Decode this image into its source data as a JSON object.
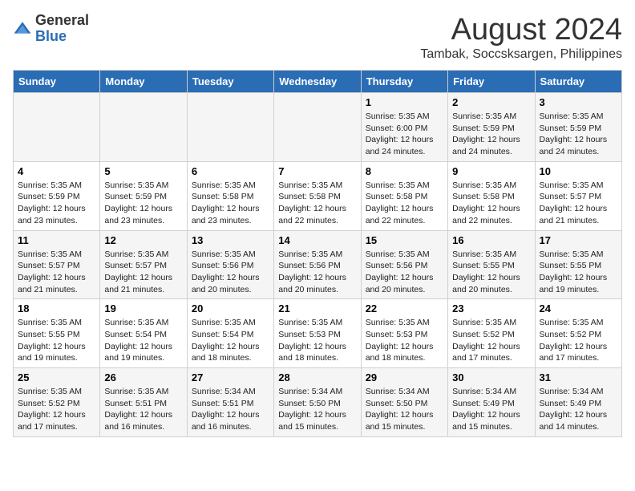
{
  "header": {
    "logo_general": "General",
    "logo_blue": "Blue",
    "month_year": "August 2024",
    "location": "Tambak, Soccsksargen, Philippines"
  },
  "days_of_week": [
    "Sunday",
    "Monday",
    "Tuesday",
    "Wednesday",
    "Thursday",
    "Friday",
    "Saturday"
  ],
  "weeks": [
    [
      {
        "day": "",
        "info": ""
      },
      {
        "day": "",
        "info": ""
      },
      {
        "day": "",
        "info": ""
      },
      {
        "day": "",
        "info": ""
      },
      {
        "day": "1",
        "info": "Sunrise: 5:35 AM\nSunset: 6:00 PM\nDaylight: 12 hours\nand 24 minutes."
      },
      {
        "day": "2",
        "info": "Sunrise: 5:35 AM\nSunset: 5:59 PM\nDaylight: 12 hours\nand 24 minutes."
      },
      {
        "day": "3",
        "info": "Sunrise: 5:35 AM\nSunset: 5:59 PM\nDaylight: 12 hours\nand 24 minutes."
      }
    ],
    [
      {
        "day": "4",
        "info": "Sunrise: 5:35 AM\nSunset: 5:59 PM\nDaylight: 12 hours\nand 23 minutes."
      },
      {
        "day": "5",
        "info": "Sunrise: 5:35 AM\nSunset: 5:59 PM\nDaylight: 12 hours\nand 23 minutes."
      },
      {
        "day": "6",
        "info": "Sunrise: 5:35 AM\nSunset: 5:58 PM\nDaylight: 12 hours\nand 23 minutes."
      },
      {
        "day": "7",
        "info": "Sunrise: 5:35 AM\nSunset: 5:58 PM\nDaylight: 12 hours\nand 22 minutes."
      },
      {
        "day": "8",
        "info": "Sunrise: 5:35 AM\nSunset: 5:58 PM\nDaylight: 12 hours\nand 22 minutes."
      },
      {
        "day": "9",
        "info": "Sunrise: 5:35 AM\nSunset: 5:58 PM\nDaylight: 12 hours\nand 22 minutes."
      },
      {
        "day": "10",
        "info": "Sunrise: 5:35 AM\nSunset: 5:57 PM\nDaylight: 12 hours\nand 21 minutes."
      }
    ],
    [
      {
        "day": "11",
        "info": "Sunrise: 5:35 AM\nSunset: 5:57 PM\nDaylight: 12 hours\nand 21 minutes."
      },
      {
        "day": "12",
        "info": "Sunrise: 5:35 AM\nSunset: 5:57 PM\nDaylight: 12 hours\nand 21 minutes."
      },
      {
        "day": "13",
        "info": "Sunrise: 5:35 AM\nSunset: 5:56 PM\nDaylight: 12 hours\nand 20 minutes."
      },
      {
        "day": "14",
        "info": "Sunrise: 5:35 AM\nSunset: 5:56 PM\nDaylight: 12 hours\nand 20 minutes."
      },
      {
        "day": "15",
        "info": "Sunrise: 5:35 AM\nSunset: 5:56 PM\nDaylight: 12 hours\nand 20 minutes."
      },
      {
        "day": "16",
        "info": "Sunrise: 5:35 AM\nSunset: 5:55 PM\nDaylight: 12 hours\nand 20 minutes."
      },
      {
        "day": "17",
        "info": "Sunrise: 5:35 AM\nSunset: 5:55 PM\nDaylight: 12 hours\nand 19 minutes."
      }
    ],
    [
      {
        "day": "18",
        "info": "Sunrise: 5:35 AM\nSunset: 5:55 PM\nDaylight: 12 hours\nand 19 minutes."
      },
      {
        "day": "19",
        "info": "Sunrise: 5:35 AM\nSunset: 5:54 PM\nDaylight: 12 hours\nand 19 minutes."
      },
      {
        "day": "20",
        "info": "Sunrise: 5:35 AM\nSunset: 5:54 PM\nDaylight: 12 hours\nand 18 minutes."
      },
      {
        "day": "21",
        "info": "Sunrise: 5:35 AM\nSunset: 5:53 PM\nDaylight: 12 hours\nand 18 minutes."
      },
      {
        "day": "22",
        "info": "Sunrise: 5:35 AM\nSunset: 5:53 PM\nDaylight: 12 hours\nand 18 minutes."
      },
      {
        "day": "23",
        "info": "Sunrise: 5:35 AM\nSunset: 5:52 PM\nDaylight: 12 hours\nand 17 minutes."
      },
      {
        "day": "24",
        "info": "Sunrise: 5:35 AM\nSunset: 5:52 PM\nDaylight: 12 hours\nand 17 minutes."
      }
    ],
    [
      {
        "day": "25",
        "info": "Sunrise: 5:35 AM\nSunset: 5:52 PM\nDaylight: 12 hours\nand 17 minutes."
      },
      {
        "day": "26",
        "info": "Sunrise: 5:35 AM\nSunset: 5:51 PM\nDaylight: 12 hours\nand 16 minutes."
      },
      {
        "day": "27",
        "info": "Sunrise: 5:34 AM\nSunset: 5:51 PM\nDaylight: 12 hours\nand 16 minutes."
      },
      {
        "day": "28",
        "info": "Sunrise: 5:34 AM\nSunset: 5:50 PM\nDaylight: 12 hours\nand 15 minutes."
      },
      {
        "day": "29",
        "info": "Sunrise: 5:34 AM\nSunset: 5:50 PM\nDaylight: 12 hours\nand 15 minutes."
      },
      {
        "day": "30",
        "info": "Sunrise: 5:34 AM\nSunset: 5:49 PM\nDaylight: 12 hours\nand 15 minutes."
      },
      {
        "day": "31",
        "info": "Sunrise: 5:34 AM\nSunset: 5:49 PM\nDaylight: 12 hours\nand 14 minutes."
      }
    ]
  ]
}
